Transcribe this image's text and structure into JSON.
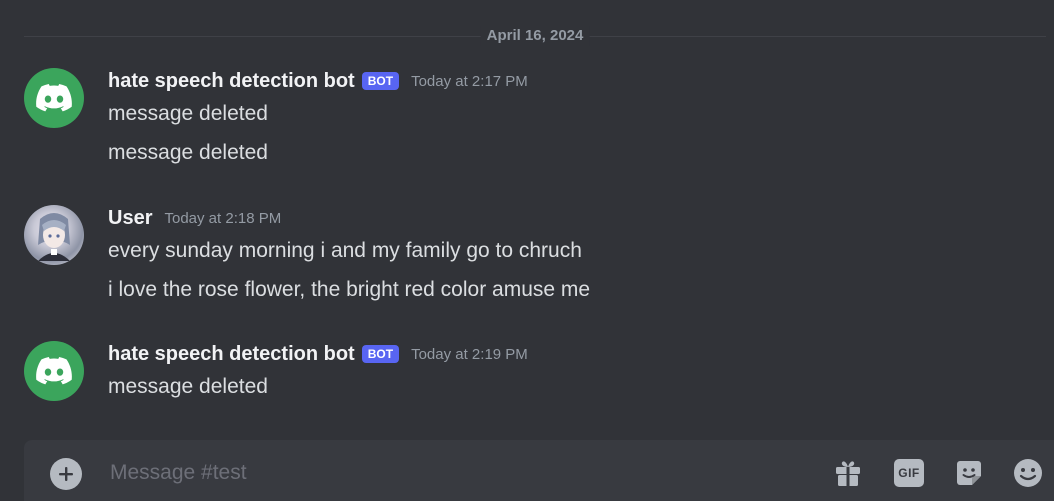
{
  "channel": {
    "date_divider": "April 16, 2024"
  },
  "messages": [
    {
      "author": "hate speech detection bot",
      "tag": "BOT",
      "time": "Today at 2:17 PM",
      "avatar": "discord-logo-icon",
      "lines": [
        "message deleted",
        "message deleted"
      ]
    },
    {
      "author": "User",
      "time": "Today at 2:18 PM",
      "avatar": "anime-avatar",
      "lines": [
        "every sunday morning i and my family go to chruch",
        "i love the rose flower, the bright red color amuse me"
      ]
    },
    {
      "author": "hate speech detection bot",
      "tag": "BOT",
      "time": "Today at 2:19 PM",
      "avatar": "discord-logo-icon",
      "lines": [
        "message deleted"
      ]
    }
  ],
  "composer": {
    "placeholder": "Message #test",
    "gif_label": "GIF",
    "icons": [
      "add-circle-icon",
      "gift-icon",
      "gif-icon",
      "sticker-icon",
      "emoji-icon"
    ]
  },
  "colors": {
    "background": "#313338",
    "composer": "#383a40",
    "bot_tag": "#5865f2",
    "bot_avatar": "#3ba55c"
  }
}
